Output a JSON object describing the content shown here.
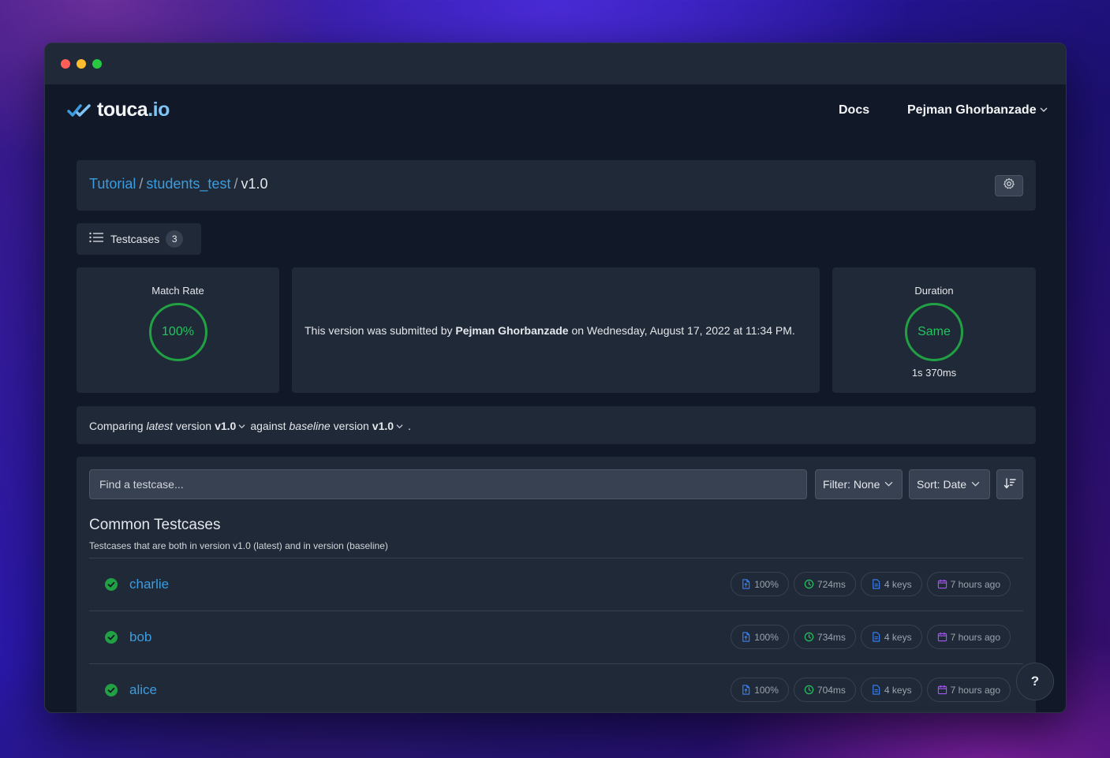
{
  "window": {
    "controls": [
      "close",
      "minimize",
      "maximize"
    ]
  },
  "nav": {
    "logo_text": "touca",
    "logo_suffix": ".io",
    "docs_label": "Docs",
    "user_name": "Pejman Ghorbanzade"
  },
  "breadcrumb": {
    "team": "Tutorial",
    "suite": "students_test",
    "version": "v1.0",
    "separator": "/"
  },
  "tabs": [
    {
      "label": "Testcases",
      "count": "3"
    }
  ],
  "stats": {
    "match_rate": {
      "title": "Match Rate",
      "value": "100%"
    },
    "submission": {
      "prefix": "This version was submitted by",
      "user": "Pejman Ghorbanzade",
      "suffix": "on Wednesday, August 17, 2022 at 11:34 PM."
    },
    "duration": {
      "title": "Duration",
      "value": "Same",
      "detail": "1s 370ms"
    }
  },
  "compare": {
    "w1": "Comparing",
    "w2": "latest",
    "w3": "version",
    "latest_version": "v1.0",
    "w4": "against",
    "w5": "baseline",
    "w6": "version",
    "baseline_version": "v1.0",
    "end": "."
  },
  "controls": {
    "search_placeholder": "Find a testcase...",
    "filter_label": "Filter: None",
    "sort_label": "Sort: Date"
  },
  "section": {
    "title": "Common Testcases",
    "subtitle": "Testcases that are both in version v1.0 (latest) and in version (baseline)"
  },
  "testcases": [
    {
      "name": "charlie",
      "match": "100%",
      "duration": "724ms",
      "keys": "4 keys",
      "time": "7 hours ago"
    },
    {
      "name": "bob",
      "match": "100%",
      "duration": "734ms",
      "keys": "4 keys",
      "time": "7 hours ago"
    },
    {
      "name": "alice",
      "match": "100%",
      "duration": "704ms",
      "keys": "4 keys",
      "time": "7 hours ago"
    }
  ],
  "help_label": "?",
  "colors": {
    "accent": "#3b9de0",
    "success": "#22c55e",
    "panel": "#1f2937",
    "background": "#111827",
    "badge_match": "#3b82f6",
    "badge_duration": "#22c55e",
    "badge_keys": "#3b82f6",
    "badge_time": "#a855f7"
  }
}
